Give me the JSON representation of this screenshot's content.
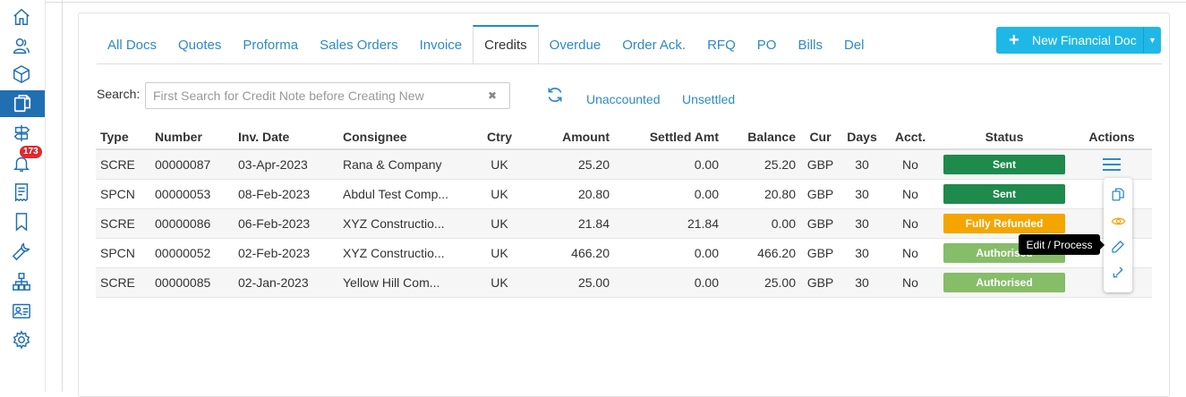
{
  "sidebar": {
    "items": [
      {
        "icon": "home-icon"
      },
      {
        "icon": "contacts-icon"
      },
      {
        "icon": "product-box-icon"
      },
      {
        "icon": "documents-icon",
        "active": true
      },
      {
        "icon": "signpost-icon"
      },
      {
        "icon": "bell-icon",
        "badge": "173"
      },
      {
        "icon": "receipt-icon"
      },
      {
        "icon": "bookmark-icon"
      },
      {
        "icon": "wrench-icon"
      },
      {
        "icon": "org-chart-icon"
      },
      {
        "icon": "id-card-icon"
      },
      {
        "icon": "gear-icon"
      }
    ]
  },
  "tabs": [
    {
      "label": "All Docs"
    },
    {
      "label": "Quotes"
    },
    {
      "label": "Proforma"
    },
    {
      "label": "Sales Orders"
    },
    {
      "label": "Invoice"
    },
    {
      "label": "Credits",
      "active": true
    },
    {
      "label": "Overdue"
    },
    {
      "label": "Order Ack."
    },
    {
      "label": "RFQ"
    },
    {
      "label": "PO"
    },
    {
      "label": "Bills"
    },
    {
      "label": "Del"
    }
  ],
  "new_button": {
    "label": "New Financial Doc"
  },
  "search": {
    "label": "Search:",
    "placeholder": "First Search for Credit Note before Creating New",
    "value": ""
  },
  "filters": {
    "unaccounted": "Unaccounted",
    "unsettled": "Unsettled"
  },
  "table": {
    "headers": [
      "Type",
      "Number",
      "Inv. Date",
      "Consignee",
      "Ctry",
      "Amount",
      "Settled Amt",
      "Balance",
      "Cur",
      "Days",
      "Acct.",
      "Status",
      "Actions"
    ],
    "rows": [
      {
        "type": "SCRE",
        "number": "00000087",
        "date": "03-Apr-2023",
        "consignee": "Rana & Company",
        "ctry": "UK",
        "amount": "25.20",
        "settled": "0.00",
        "balance": "25.20",
        "cur": "GBP",
        "days": "30",
        "acct": "No",
        "status": "Sent",
        "status_color": "#1e8a4c"
      },
      {
        "type": "SPCN",
        "number": "00000053",
        "date": "08-Feb-2023",
        "consignee": "Abdul Test Comp...",
        "ctry": "UK",
        "amount": "20.80",
        "settled": "0.00",
        "balance": "20.80",
        "cur": "GBP",
        "days": "30",
        "acct": "No",
        "status": "Sent",
        "status_color": "#1e8a4c"
      },
      {
        "type": "SCRE",
        "number": "00000086",
        "date": "06-Feb-2023",
        "consignee": "XYZ Constructio...",
        "ctry": "UK",
        "amount": "21.84",
        "settled": "21.84",
        "balance": "0.00",
        "cur": "GBP",
        "days": "30",
        "acct": "No",
        "status": "Fully Refunded",
        "status_color": "#f5a500"
      },
      {
        "type": "SPCN",
        "number": "00000052",
        "date": "02-Feb-2023",
        "consignee": "XYZ Constructio...",
        "ctry": "UK",
        "amount": "466.20",
        "settled": "0.00",
        "balance": "466.20",
        "cur": "GBP",
        "days": "30",
        "acct": "No",
        "status": "Authorised",
        "status_color": "#86bd68"
      },
      {
        "type": "SCRE",
        "number": "00000085",
        "date": "02-Jan-2023",
        "consignee": "Yellow Hill Com...",
        "ctry": "UK",
        "amount": "25.00",
        "settled": "0.00",
        "balance": "25.00",
        "cur": "GBP",
        "days": "30",
        "acct": "No",
        "status": "Authorised",
        "status_color": "#86bd68"
      }
    ]
  },
  "actions_menu": {
    "items": [
      "copy-icon",
      "view-eye-icon",
      "edit-pencil-icon",
      "transfer-arrows-icon"
    ],
    "tooltip": "Edit / Process"
  },
  "colors": {
    "accent": "#1f6fb2",
    "link": "#2d8ac7",
    "new_button": "#1fb8e6",
    "badge": "#e0282e"
  }
}
